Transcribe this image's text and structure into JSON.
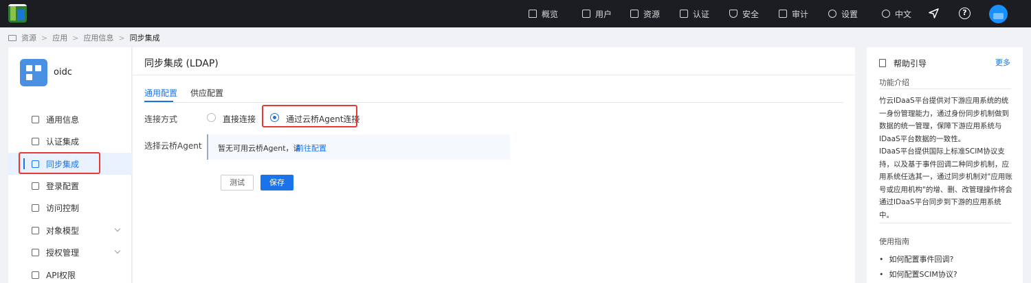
{
  "topnav": {
    "items": [
      {
        "label": "概览",
        "icon": "home-icon"
      },
      {
        "label": "用户",
        "icon": "user-icon"
      },
      {
        "label": "资源",
        "icon": "folder-icon"
      },
      {
        "label": "认证",
        "icon": "monitor-icon"
      },
      {
        "label": "安全",
        "icon": "shield-icon"
      },
      {
        "label": "审计",
        "icon": "audit-icon"
      },
      {
        "label": "设置",
        "icon": "gear-icon"
      },
      {
        "label": "中文",
        "icon": "globe-icon"
      }
    ],
    "help_symbol": "?"
  },
  "breadcrumb": {
    "items": [
      "资源",
      "应用",
      "应用信息"
    ],
    "current": "同步集成",
    "separator": ">"
  },
  "sidebar": {
    "app_name": "oidc",
    "items": [
      {
        "label": "通用信息",
        "icon": "document-icon"
      },
      {
        "label": "认证集成",
        "icon": "sliders-icon"
      },
      {
        "label": "同步集成",
        "icon": "sync-icon",
        "active": true
      },
      {
        "label": "登录配置",
        "icon": "login-icon"
      },
      {
        "label": "访问控制",
        "icon": "access-icon"
      },
      {
        "label": "对象模型",
        "icon": "model-icon",
        "expandable": true
      },
      {
        "label": "授权管理",
        "icon": "key-icon",
        "expandable": true
      },
      {
        "label": "API权限",
        "icon": "api-icon"
      }
    ]
  },
  "main": {
    "title": "同步集成 (LDAP)",
    "tabs": [
      {
        "label": "通用配置",
        "active": true
      },
      {
        "label": "供应配置",
        "active": false
      }
    ],
    "connection_label": "连接方式",
    "options": [
      {
        "label": "直接连接",
        "checked": false
      },
      {
        "label": "通过云桥Agent连接",
        "checked": true
      }
    ],
    "agent_label": "选择云桥Agent",
    "agent_message": "暂无可用云桥Agent，请",
    "agent_link": "前往配置",
    "test_button": "测试",
    "save_button": "保存"
  },
  "help": {
    "title": "帮助引导",
    "more": "更多",
    "intro_title": "功能介绍",
    "intro_paragraphs": [
      "竹云IDaaS平台提供对下游应用系统的统一身份管理能力，通过身份同步机制做到数据的统一管理，保障下游应用系统与IDaaS平台数据的一致性。",
      "IDaaS平台提供国际上标准SCIM协议支持，以及基于事件回调二种同步机制，应用系统任选其一，通过同步机制对\"应用账号或应用机构\"的增、删、改管理操作将会通过IDaaS平台同步到下游的应用系统中。"
    ],
    "guide_title": "使用指南",
    "guide_items": [
      "如何配置事件回调?",
      "如何配置SCIM协议?"
    ]
  },
  "colors": {
    "accent": "#1a73e8",
    "highlight": "#e53935",
    "topbar": "#1b1d22"
  }
}
